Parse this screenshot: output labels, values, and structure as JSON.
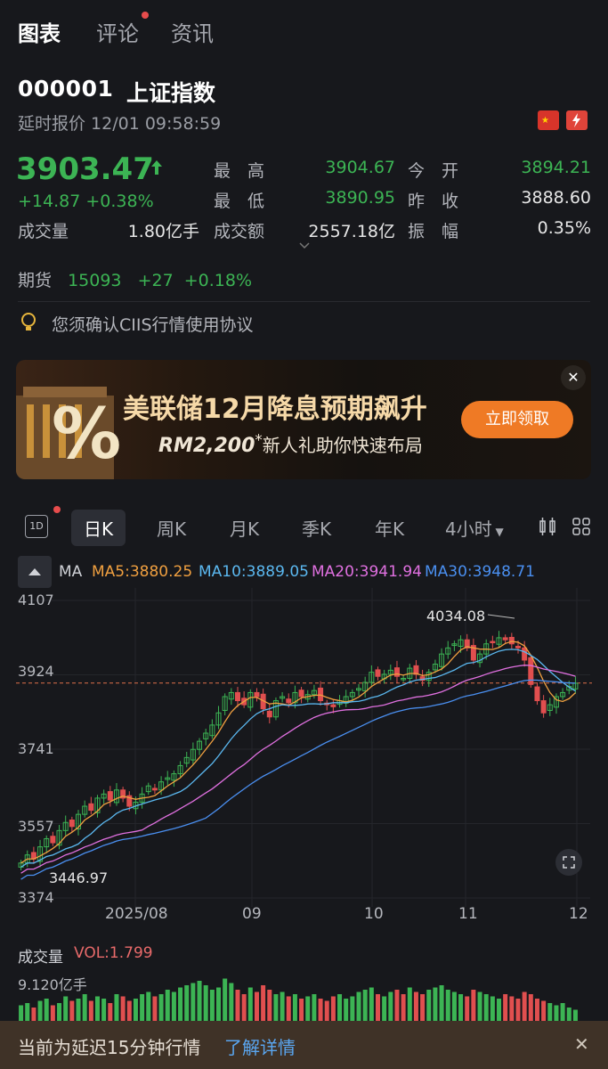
{
  "tabs": [
    {
      "label": "图表"
    },
    {
      "label": "评论"
    },
    {
      "label": "资讯"
    }
  ],
  "stock": {
    "code": "000001",
    "name": "上证指数",
    "status": "延时报价 12/01 09:58:59",
    "price": "3903.47",
    "change": "+14.87",
    "change_pct": "+0.38%"
  },
  "stats": {
    "high_label": "最　高",
    "high": "3904.67",
    "open_label": "今　开",
    "open": "3894.21",
    "low_label": "最　低",
    "low": "3890.95",
    "prev_label": "昨　收",
    "prev": "3888.60",
    "vol_label": "成交量",
    "vol": "1.80亿手",
    "amt_label": "成交额",
    "amt": "2557.18亿",
    "amp_label": "振　幅",
    "amp": "0.35%"
  },
  "futures": {
    "label": "期货",
    "value": "15093",
    "change": "+27",
    "pct": "+0.18%"
  },
  "notice": "您须确认CIIS行情使用协议",
  "banner": {
    "title": "美联储12月降息预期飙升",
    "sub_amount": "RM2,200",
    "sub_star": "*",
    "sub_text": "新人礼助你快速布局",
    "button": "立即领取",
    "close": "✕"
  },
  "periods": [
    "日K",
    "周K",
    "月K",
    "季K",
    "年K",
    "4小时"
  ],
  "badge_1d": "1D",
  "ma": {
    "label": "MA",
    "ma5": "MA5:3880.25",
    "ma10": "MA10:3889.05",
    "ma20": "MA20:3941.94",
    "ma30": "MA30:3948.71",
    "colors": {
      "ma5": "#f0a040",
      "ma10": "#5bb8f0",
      "ma20": "#e070e0",
      "ma30": "#4a8ff0"
    }
  },
  "chart_data": {
    "type": "candlestick",
    "ylim": [
      3374,
      4107
    ],
    "y_ticks": [
      "4107",
      "3924",
      "3741",
      "3557",
      "3374"
    ],
    "x_ticks": [
      "2025/08",
      "09",
      "10",
      "11",
      "12"
    ],
    "high_annotation": "4034.08",
    "low_annotation": "3446.97",
    "current_line": 3903.47,
    "closes": [
      3460,
      3480,
      3470,
      3500,
      3520,
      3510,
      3540,
      3560,
      3550,
      3580,
      3600,
      3590,
      3620,
      3630,
      3615,
      3640,
      3620,
      3600,
      3610,
      3630,
      3650,
      3640,
      3660,
      3670,
      3680,
      3700,
      3720,
      3740,
      3760,
      3780,
      3800,
      3830,
      3870,
      3880,
      3860,
      3850,
      3880,
      3870,
      3840,
      3820,
      3860,
      3870,
      3855,
      3880,
      3870,
      3875,
      3885,
      3860,
      3850,
      3845,
      3860,
      3870,
      3880,
      3890,
      3905,
      3930,
      3920,
      3925,
      3935,
      3920,
      3915,
      3940,
      3925,
      3910,
      3930,
      3950,
      3975,
      3990,
      4000,
      4010,
      3990,
      3960,
      3975,
      4000,
      4005,
      4015,
      4010,
      4000,
      3990,
      3960,
      3900,
      3860,
      3830,
      3850,
      3870,
      3880,
      3895,
      3903
    ]
  },
  "volume": {
    "label": "成交量",
    "vol_value": "VOL:1.799",
    "top_tick": "9.120亿手",
    "bars": [
      0.35,
      0.4,
      0.3,
      0.45,
      0.5,
      0.35,
      0.4,
      0.55,
      0.45,
      0.5,
      0.6,
      0.45,
      0.55,
      0.5,
      0.4,
      0.6,
      0.55,
      0.45,
      0.5,
      0.6,
      0.65,
      0.55,
      0.6,
      0.7,
      0.65,
      0.75,
      0.8,
      0.85,
      0.9,
      0.8,
      0.7,
      0.75,
      0.95,
      0.85,
      0.7,
      0.6,
      0.75,
      0.65,
      0.8,
      0.7,
      0.6,
      0.65,
      0.55,
      0.6,
      0.5,
      0.55,
      0.6,
      0.5,
      0.45,
      0.55,
      0.6,
      0.5,
      0.55,
      0.65,
      0.7,
      0.75,
      0.6,
      0.55,
      0.65,
      0.7,
      0.6,
      0.75,
      0.65,
      0.6,
      0.7,
      0.75,
      0.8,
      0.7,
      0.65,
      0.6,
      0.55,
      0.7,
      0.65,
      0.6,
      0.55,
      0.5,
      0.6,
      0.55,
      0.5,
      0.65,
      0.6,
      0.5,
      0.45,
      0.4,
      0.35,
      0.4,
      0.3,
      0.25
    ]
  },
  "bottom_bar": {
    "text": "当前为延迟15分钟行情",
    "link": "了解详情",
    "close": "✕"
  }
}
